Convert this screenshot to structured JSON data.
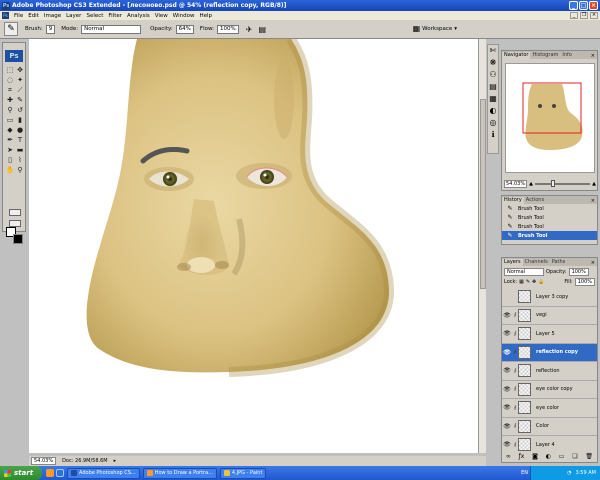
{
  "window": {
    "title": "Adobe Photoshop CS3 Extended - [лесоново.psd @ 54% (reflection copy, RGB/8)]",
    "ps_badge": "Ps"
  },
  "menu": [
    "File",
    "Edit",
    "Image",
    "Layer",
    "Select",
    "Filter",
    "Analysis",
    "View",
    "Window",
    "Help"
  ],
  "options": {
    "brush_label": "Brush:",
    "brush_size": "9",
    "mode_label": "Mode:",
    "mode_value": "Normal",
    "opacity_label": "Opacity:",
    "opacity_value": "64%",
    "flow_label": "Flow:",
    "flow_value": "100%",
    "workspace_label": "Workspace"
  },
  "status": {
    "zoom": "54.03%",
    "doc": "Doc: 26.9M/58.6M"
  },
  "navigator": {
    "tabs": [
      "Navigator",
      "Histogram",
      "Info"
    ],
    "zoom": "54.03%"
  },
  "history": {
    "tabs": [
      "History",
      "Actions"
    ],
    "items": [
      "Brush Tool",
      "Brush Tool",
      "Brush Tool",
      "Brush Tool"
    ]
  },
  "layers": {
    "tabs": [
      "Layers",
      "Channels",
      "Paths"
    ],
    "blend_mode": "Normal",
    "opacity_label": "Opacity:",
    "opacity_value": "100%",
    "lock_label": "Lock:",
    "fill_label": "Fill:",
    "fill_value": "100%",
    "items": [
      "Layer 3 copy",
      "vegi",
      "Layer 5",
      "reflection copy",
      "reflection",
      "eye color copy",
      "eye color",
      "Color",
      "Layer 4"
    ],
    "selected_index": 3
  },
  "taskbar": {
    "start": "start",
    "tasks": [
      "Adobe Photoshop CS...",
      "How to Draw a Portra...",
      "4.JPG - Paint"
    ],
    "lang": "EN",
    "clock": "3:59 AM"
  },
  "colors": {
    "skin": "#e4cc8c",
    "selected": "#316ac5",
    "titlebar": "#1f58c8"
  }
}
